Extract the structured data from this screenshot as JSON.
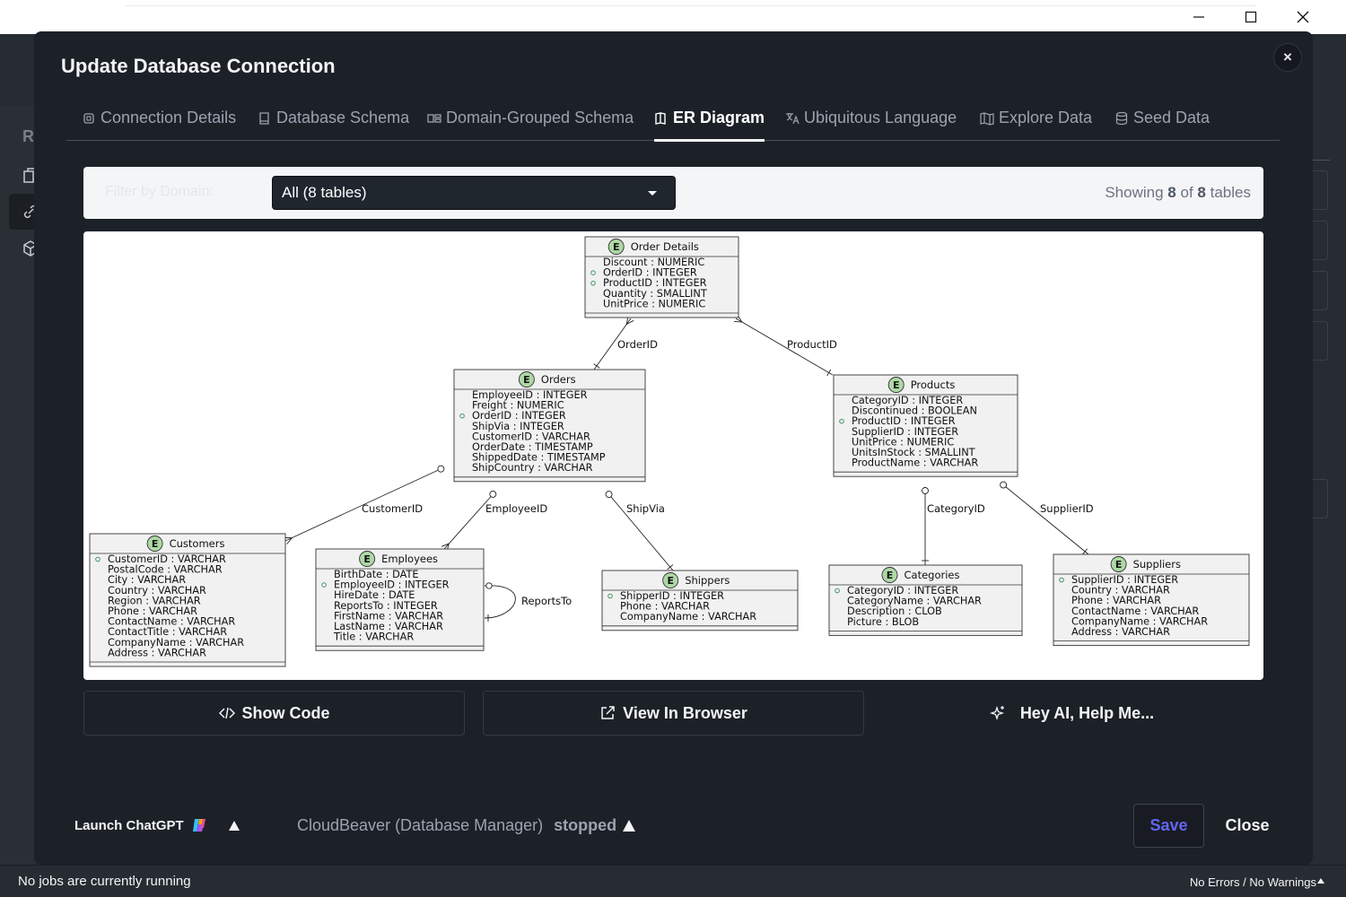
{
  "window_controls": {
    "minimize": "minimize",
    "maximize": "maximize",
    "close": "close"
  },
  "background": {
    "sidebar_letter": "R"
  },
  "modal": {
    "title": "Update Database Connection",
    "close_symbol": "×",
    "tabs": [
      {
        "label": "Connection Details",
        "icon": "gear-icon"
      },
      {
        "label": "Database Schema",
        "icon": "book-icon"
      },
      {
        "label": "Domain-Grouped Schema",
        "icon": "grouping-icon"
      },
      {
        "label": "ER Diagram",
        "icon": "diagram-icon",
        "active": true
      },
      {
        "label": "Ubiquitous Language",
        "icon": "translate-icon"
      },
      {
        "label": "Explore Data",
        "icon": "map-icon"
      },
      {
        "label": "Seed Data",
        "icon": "database-icon"
      }
    ]
  },
  "filter": {
    "label": "Filter by Domain:",
    "selected": "All (8 tables)",
    "showing_prefix": "Showing",
    "showing_count": "8",
    "showing_of": "of",
    "showing_total": "8",
    "showing_suffix": "tables"
  },
  "er_diagram": {
    "entity_marker": "E",
    "entities": [
      {
        "name": "Order Details",
        "fields": [
          {
            "text": "Discount : NUMERIC",
            "key": false
          },
          {
            "text": "OrderID : INTEGER",
            "key": true
          },
          {
            "text": "ProductID : INTEGER",
            "key": true
          },
          {
            "text": "Quantity : SMALLINT",
            "key": false
          },
          {
            "text": "UnitPrice : NUMERIC",
            "key": false
          }
        ]
      },
      {
        "name": "Orders",
        "fields": [
          {
            "text": "EmployeeID : INTEGER",
            "key": false
          },
          {
            "text": "Freight : NUMERIC",
            "key": false
          },
          {
            "text": "OrderID : INTEGER",
            "key": true
          },
          {
            "text": "ShipVia : INTEGER",
            "key": false
          },
          {
            "text": "CustomerID : VARCHAR",
            "key": false
          },
          {
            "text": "OrderDate : TIMESTAMP",
            "key": false
          },
          {
            "text": "ShippedDate : TIMESTAMP",
            "key": false
          },
          {
            "text": "ShipCountry : VARCHAR",
            "key": false
          }
        ]
      },
      {
        "name": "Products",
        "fields": [
          {
            "text": "CategoryID : INTEGER",
            "key": false
          },
          {
            "text": "Discontinued : BOOLEAN",
            "key": false
          },
          {
            "text": "ProductID : INTEGER",
            "key": true
          },
          {
            "text": "SupplierID : INTEGER",
            "key": false
          },
          {
            "text": "UnitPrice : NUMERIC",
            "key": false
          },
          {
            "text": "UnitsInStock : SMALLINT",
            "key": false
          },
          {
            "text": "ProductName : VARCHAR",
            "key": false
          }
        ]
      },
      {
        "name": "Customers",
        "fields": [
          {
            "text": "CustomerID : VARCHAR",
            "key": true
          },
          {
            "text": "PostalCode : VARCHAR",
            "key": false
          },
          {
            "text": "City : VARCHAR",
            "key": false
          },
          {
            "text": "Country : VARCHAR",
            "key": false
          },
          {
            "text": "Region : VARCHAR",
            "key": false
          },
          {
            "text": "Phone : VARCHAR",
            "key": false
          },
          {
            "text": "ContactName : VARCHAR",
            "key": false
          },
          {
            "text": "ContactTitle : VARCHAR",
            "key": false
          },
          {
            "text": "CompanyName : VARCHAR",
            "key": false
          },
          {
            "text": "Address : VARCHAR",
            "key": false
          }
        ]
      },
      {
        "name": "Employees",
        "fields": [
          {
            "text": "BirthDate : DATE",
            "key": false
          },
          {
            "text": "EmployeeID : INTEGER",
            "key": true
          },
          {
            "text": "HireDate : DATE",
            "key": false
          },
          {
            "text": "ReportsTo : INTEGER",
            "key": false
          },
          {
            "text": "FirstName : VARCHAR",
            "key": false
          },
          {
            "text": "LastName : VARCHAR",
            "key": false
          },
          {
            "text": "Title : VARCHAR",
            "key": false
          }
        ]
      },
      {
        "name": "Shippers",
        "fields": [
          {
            "text": "ShipperID : INTEGER",
            "key": true
          },
          {
            "text": "Phone : VARCHAR",
            "key": false
          },
          {
            "text": "CompanyName : VARCHAR",
            "key": false
          }
        ]
      },
      {
        "name": "Categories",
        "fields": [
          {
            "text": "CategoryID : INTEGER",
            "key": true
          },
          {
            "text": "CategoryName : VARCHAR",
            "key": false
          },
          {
            "text": "Description : CLOB",
            "key": false
          },
          {
            "text": "Picture : BLOB",
            "key": false
          }
        ]
      },
      {
        "name": "Suppliers",
        "fields": [
          {
            "text": "SupplierID : INTEGER",
            "key": true
          },
          {
            "text": "Country : VARCHAR",
            "key": false
          },
          {
            "text": "Phone : VARCHAR",
            "key": false
          },
          {
            "text": "ContactName : VARCHAR",
            "key": false
          },
          {
            "text": "CompanyName : VARCHAR",
            "key": false
          },
          {
            "text": "Address : VARCHAR",
            "key": false
          }
        ]
      }
    ],
    "relations": [
      {
        "from": "Orders",
        "to": "Order Details",
        "label": "OrderID"
      },
      {
        "from": "Products",
        "to": "Order Details",
        "label": "ProductID"
      },
      {
        "from": "Customers",
        "to": "Orders",
        "label": "CustomerID"
      },
      {
        "from": "Employees",
        "to": "Orders",
        "label": "EmployeeID"
      },
      {
        "from": "Shippers",
        "to": "Orders",
        "label": "ShipVia"
      },
      {
        "from": "Categories",
        "to": "Products",
        "label": "CategoryID"
      },
      {
        "from": "Suppliers",
        "to": "Products",
        "label": "SupplierID"
      },
      {
        "from": "Employees",
        "to": "Employees",
        "label": "ReportsTo"
      }
    ]
  },
  "actions": {
    "show_code": "Show Code",
    "view_in_browser": "View In Browser",
    "ai_help": "Hey AI, Help Me..."
  },
  "footer": {
    "launch_chatgpt": "Launch ChatGPT",
    "cloudbeaver_name": "CloudBeaver (Database Manager)",
    "cloudbeaver_status": "stopped",
    "save": "Save",
    "close": "Close"
  },
  "statusbar": {
    "jobs": "No jobs are currently running",
    "problems": "No Errors / No Warnings"
  }
}
